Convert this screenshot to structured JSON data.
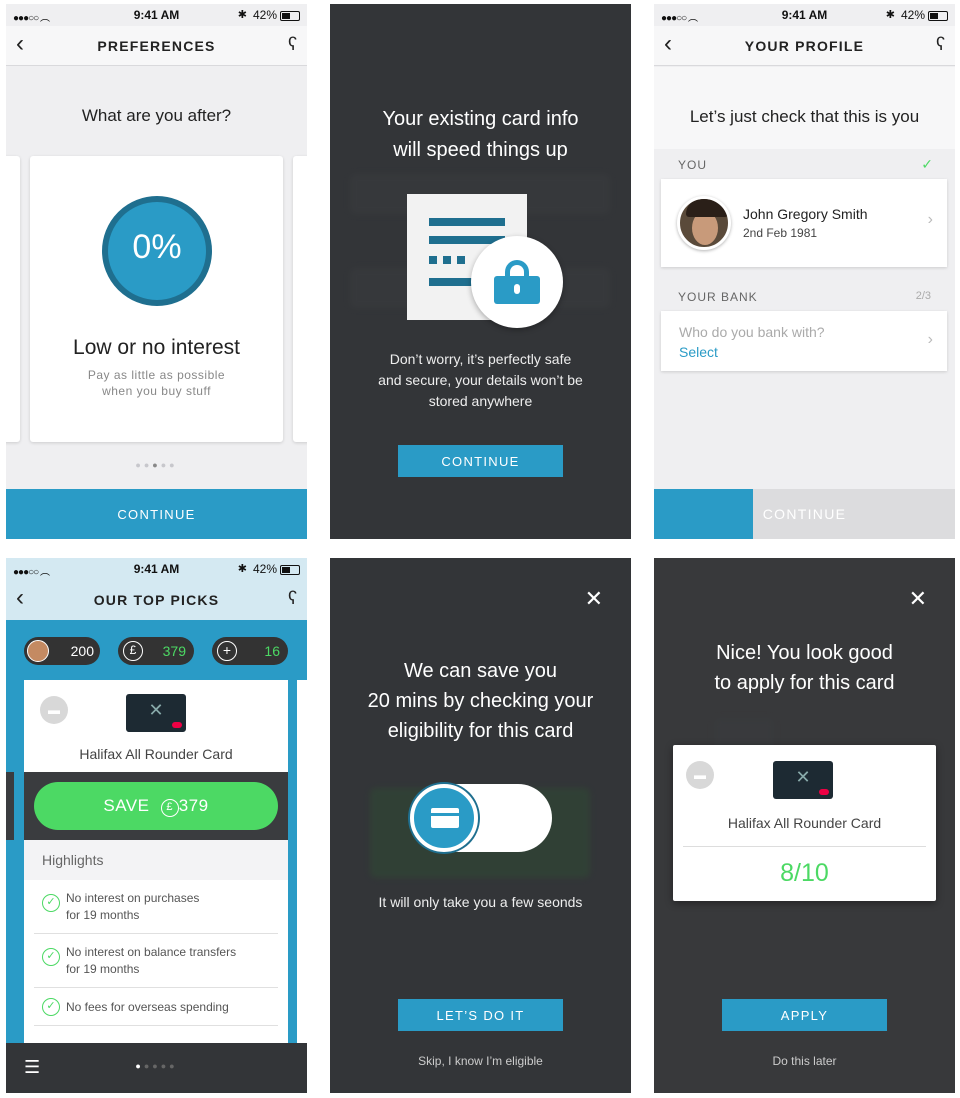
{
  "status": {
    "time": "9:41 AM",
    "battery": "42%"
  },
  "screen1": {
    "title": "PREFERENCES",
    "heading": "What are you after?",
    "badge": "0%",
    "card_title": "Low or no interest",
    "card_sub_1": "Pay as little as possible",
    "card_sub_2": "when you buy stuff",
    "continue": "CONTINUE"
  },
  "screen2": {
    "heading_1": "Your existing card info",
    "heading_2": "will speed things up",
    "body_1": "Don’t worry, it’s perfectly safe",
    "body_2": "and secure, your details won’t be",
    "body_3": "stored anywhere",
    "continue": "CONTINUE"
  },
  "screen3": {
    "title": "YOUR PROFILE",
    "heading": "Let’s just check that this is you",
    "you_label": "YOU",
    "name": "John Gregory Smith",
    "dob": "2nd Feb 1981",
    "bank_label": "YOUR BANK",
    "bank_step": "2/3",
    "bank_question": "Who do you bank with?",
    "bank_select": "Select",
    "continue": "CONTINUE",
    "progress": 0.33
  },
  "screen4": {
    "title": "OUR TOP PICKS",
    "stat_points": "200",
    "stat_money": "379",
    "stat_plus": "16",
    "card_name": "Halifax All Rounder Card",
    "save_label": "SAVE",
    "save_amount": "379",
    "highlights_label": "Highlights",
    "highlights": [
      {
        "l1": "No interest on purchases",
        "l2": "for 19 months"
      },
      {
        "l1": "No interest on balance transfers",
        "l2": "for 19 months"
      },
      {
        "l1": "No fees for overseas spending",
        "l2": ""
      }
    ],
    "accent": "#4cd964"
  },
  "screen5": {
    "heading_1": "We can save you",
    "heading_2": "20 mins by checking your",
    "heading_3": "eligibility for this card",
    "body": "It will only take you a few seonds",
    "cta": "LET’S DO IT",
    "skip": "Skip, I know I’m eligible"
  },
  "screen6": {
    "heading_1": "Nice! You look good",
    "heading_2": "to apply for this card",
    "card_name": "Halifax All Rounder Card",
    "score": "8/10",
    "cta": "APPLY",
    "later": "Do this later"
  },
  "colors": {
    "brand_blue": "#2a9bc6",
    "dark_blue": "#1f6f8f",
    "green": "#4cd964"
  }
}
